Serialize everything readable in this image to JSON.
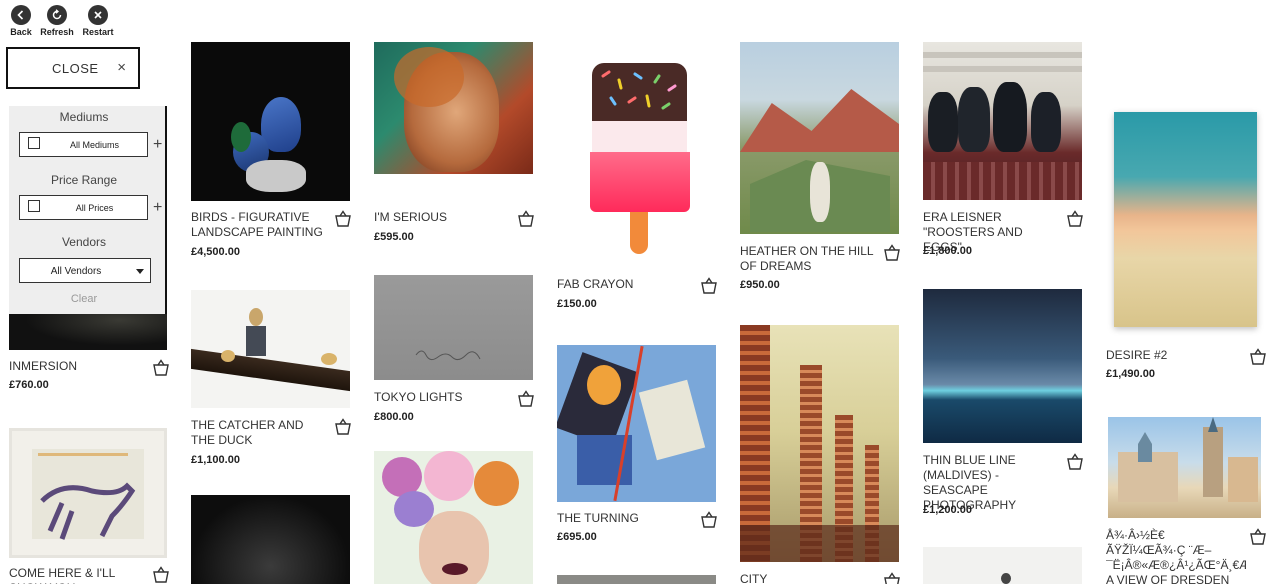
{
  "nav": {
    "back": "Back",
    "refresh": "Refresh",
    "restart": "Restart"
  },
  "close": {
    "label": "CLOSE",
    "icon": "×"
  },
  "filters": {
    "mediums_heading": "Mediums",
    "mediums_value": "All Mediums",
    "price_heading": "Price Range",
    "price_value": "All Prices",
    "vendors_heading": "Vendors",
    "vendors_value": "All Vendors",
    "clear": "Clear",
    "plus": "+"
  },
  "products": [
    {
      "title": "INMERSION",
      "price": "£760.00"
    },
    {
      "title": "COME HERE & I'LL SHOW YOU SOMETHING",
      "price": ""
    },
    {
      "title": "BIRDS - FIGURATIVE LANDSCAPE PAINTING",
      "price": "£4,500.00"
    },
    {
      "title": "THE CATCHER AND THE DUCK",
      "price": "£1,100.00"
    },
    {
      "title": "I'M SERIOUS",
      "price": "£595.00"
    },
    {
      "title": "TOKYO LIGHTS",
      "price": "£800.00"
    },
    {
      "title": "FAB CRAYON",
      "price": "£150.00"
    },
    {
      "title": "THE TURNING",
      "price": "£695.00"
    },
    {
      "title": "HEATHER ON THE HILL OF DREAMS",
      "price": "£950.00"
    },
    {
      "title": "CITY",
      "price": ""
    },
    {
      "title": "ERA LEISNER \"ROOSTERS AND EGGS\"",
      "price": "£1,800.00"
    },
    {
      "title": "THIN BLUE LINE (MALDIVES) - SEASCAPE PHOTOGRAPHY",
      "price": "£1,200.00"
    },
    {
      "title": "DESIRE #2",
      "price": "£1,490.00"
    },
    {
      "title": "Å¾·Â›½È€ ÃŸŽÏ¼ŒÃ¾·Ç ¨Æ– ¯Ë¡Â®«Æ®¿Â¹¿ÃŒ°Ä¸€Æ™ A VIEW OF DRESDEN PALACE",
      "price": ""
    }
  ],
  "colors": {
    "accent": "#111111",
    "panel": "#eeeeee",
    "clear": "#999999"
  }
}
